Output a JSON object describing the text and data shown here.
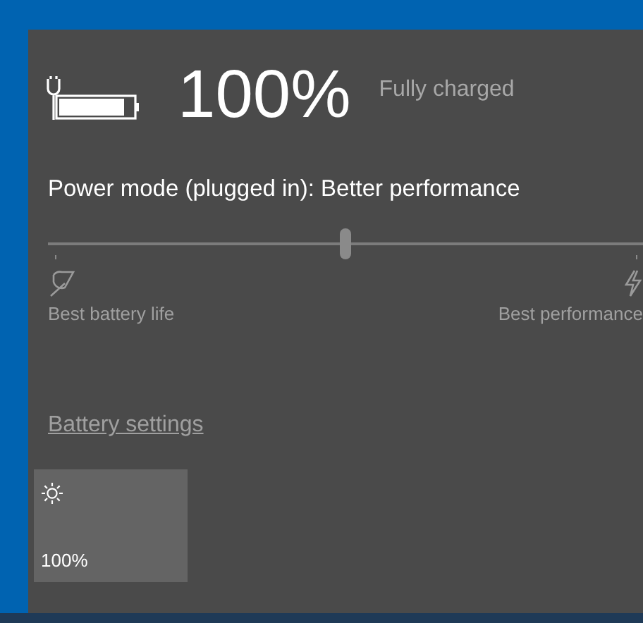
{
  "battery": {
    "percent": "100%",
    "status": "Fully charged"
  },
  "power_mode": {
    "label": "Power mode (plugged in): Better performance",
    "level": 0.5,
    "left_label": "Best battery life",
    "right_label": "Best performance"
  },
  "settings_link": "Battery settings",
  "quick_actions": [
    {
      "kind": "brightness",
      "label": "100%"
    }
  ]
}
